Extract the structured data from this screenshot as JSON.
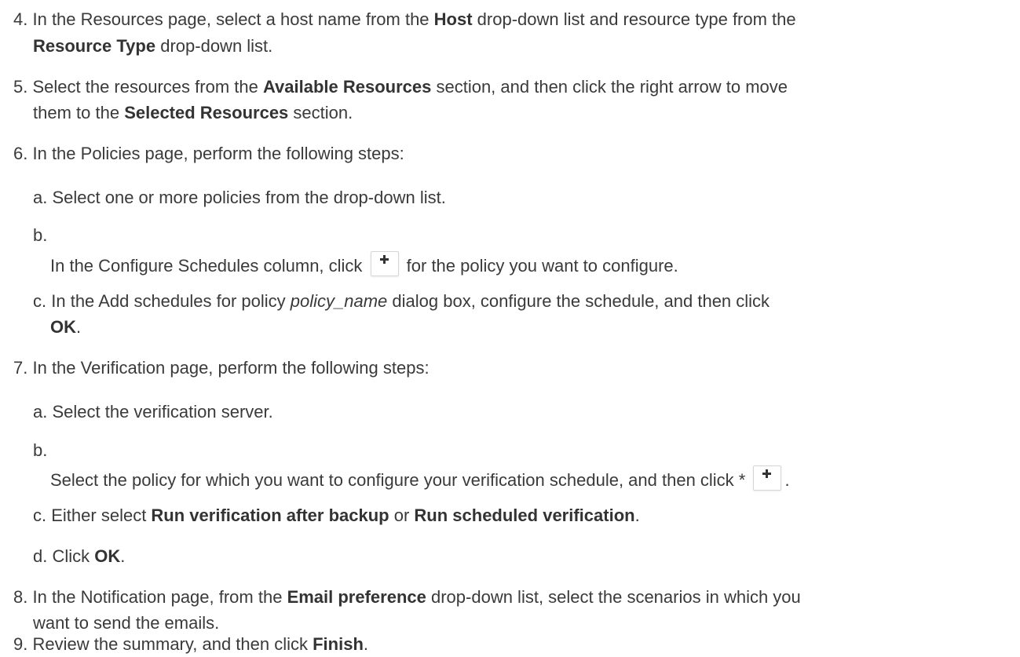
{
  "steps": [
    {
      "number": "4.",
      "lines": [
        [
          "In the Resources page, select a host name from the ",
          "Host",
          " drop-down list and resource type from the"
        ],
        [
          "Resource Type",
          " drop-down list."
        ]
      ]
    },
    {
      "number": "5.",
      "lines": [
        [
          "Select the resources from the ",
          "Available Resources",
          " section, and then click the right arrow to move"
        ],
        [
          "them to the ",
          "Selected Resources",
          " section."
        ]
      ]
    },
    {
      "number": "6.",
      "text": "In the Policies page, perform the following steps:",
      "substeps": {
        "a": {
          "label": "a.",
          "text": "Select one or more policies from the drop-down list."
        },
        "b": {
          "label": "b.",
          "before": "In the Configure Schedules column, click ",
          "after": " for the policy you want to configure."
        },
        "c": {
          "label": "c.",
          "p1": "In the Add schedules for policy ",
          "italic": "policy_name",
          "p2": " dialog box, configure the schedule, and then click",
          "bold": "OK",
          "end": "."
        }
      }
    },
    {
      "number": "7.",
      "text": "In the Verification page, perform the following steps:",
      "substeps": {
        "a": {
          "label": "a.",
          "text": "Select the verification server."
        },
        "b": {
          "label": "b.",
          "before": "Select the policy for which you want to configure your verification schedule, and then click * ",
          "after": "."
        },
        "c": {
          "label": "c.",
          "p1": "Either select ",
          "bold1": "Run verification after backup",
          "p2": " or ",
          "bold2": "Run scheduled verification",
          "end": "."
        },
        "d": {
          "label": "d.",
          "p1": "Click ",
          "bold": "OK",
          "end": "."
        }
      }
    },
    {
      "number": "8.",
      "lines": [
        [
          "In the Notification page, from the ",
          "Email preference",
          " drop-down list, select the scenarios in which you"
        ],
        [
          "want to send the emails."
        ]
      ]
    },
    {
      "number": "9.",
      "p1": "Review the summary, and then click ",
      "bold": "Finish",
      "end": "."
    }
  ],
  "icons": {
    "add": "plus-icon",
    "accent": "#333333"
  }
}
